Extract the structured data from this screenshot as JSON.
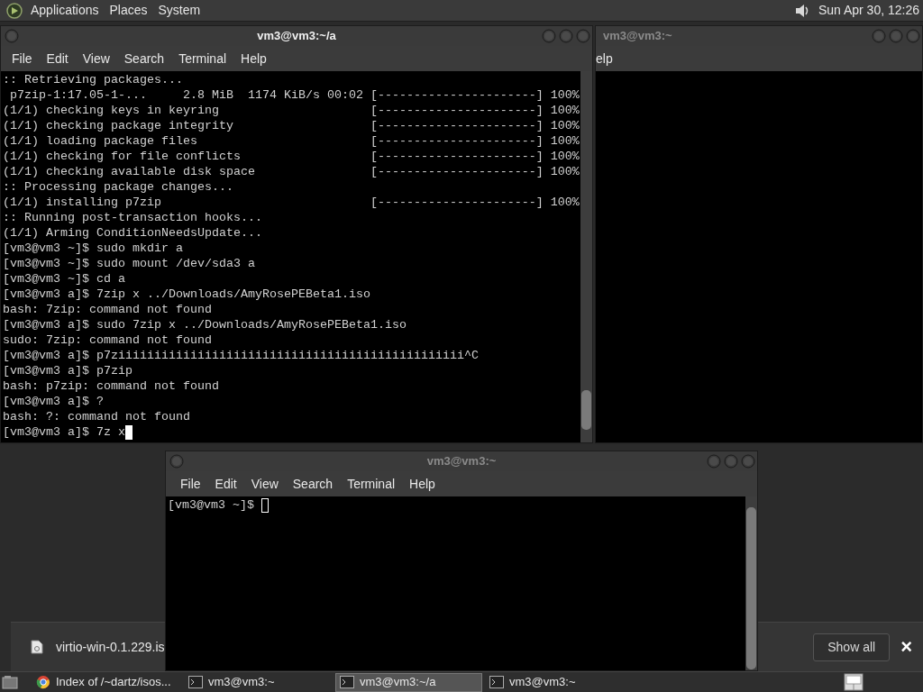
{
  "top_panel": {
    "menus": [
      "Applications",
      "Places",
      "System"
    ],
    "clock": "Sun Apr 30, 12:26"
  },
  "windows": [
    {
      "title": "vm3@vm3:~/a",
      "focused": true,
      "menu": [
        "File",
        "Edit",
        "View",
        "Search",
        "Terminal",
        "Help"
      ],
      "cursor": true,
      "lines": [
        ":: Retrieving packages...",
        " p7zip-1:17.05-1-...     2.8 MiB  1174 KiB/s 00:02 [----------------------] 100%",
        "(1/1) checking keys in keyring                     [----------------------] 100%",
        "(1/1) checking package integrity                   [----------------------] 100%",
        "(1/1) loading package files                        [----------------------] 100%",
        "(1/1) checking for file conflicts                  [----------------------] 100%",
        "(1/1) checking available disk space                [----------------------] 100%",
        ":: Processing package changes...",
        "(1/1) installing p7zip                             [----------------------] 100%",
        ":: Running post-transaction hooks...",
        "(1/1) Arming ConditionNeedsUpdate...",
        "[vm3@vm3 ~]$ sudo mkdir a",
        "[vm3@vm3 ~]$ sudo mount /dev/sda3 a",
        "[vm3@vm3 ~]$ cd a",
        "[vm3@vm3 a]$ 7zip x ../Downloads/AmyRosePEBeta1.iso",
        "bash: 7zip: command not found",
        "[vm3@vm3 a]$ sudo 7zip x ../Downloads/AmyRosePEBeta1.iso",
        "sudo: 7zip: command not found",
        "[vm3@vm3 a]$ p7ziiiiiiiiiiiiiiiiiiiiiiiiiiiiiiiiiiiiiiiiiiiiiiii^C",
        "[vm3@vm3 a]$ p7zip",
        "bash: p7zip: command not found",
        "[vm3@vm3 a]$ ?",
        "bash: ?: command not found",
        "[vm3@vm3 a]$ 7z x"
      ]
    },
    {
      "title": "vm3@vm3:~",
      "focused": false,
      "menu": [
        "elp"
      ]
    },
    {
      "title": "vm3@vm3:~",
      "focused": false,
      "menu": [
        "File",
        "Edit",
        "View",
        "Search",
        "Terminal",
        "Help"
      ],
      "cursor": true,
      "lines": [
        "[vm3@vm3 ~]$ "
      ]
    }
  ],
  "download_bar": {
    "file": "virtio-win-0.1.229.is",
    "button": "Show all",
    "close": "×"
  },
  "taskbar": {
    "items": [
      {
        "kind": "browser",
        "label": "Index of /~dartz/isos...",
        "selected": false
      },
      {
        "kind": "terminal",
        "label": "vm3@vm3:~",
        "selected": false
      },
      {
        "kind": "terminal",
        "label": "vm3@vm3:~/a",
        "selected": true
      },
      {
        "kind": "terminal",
        "label": "vm3@vm3:~",
        "selected": false
      }
    ]
  }
}
